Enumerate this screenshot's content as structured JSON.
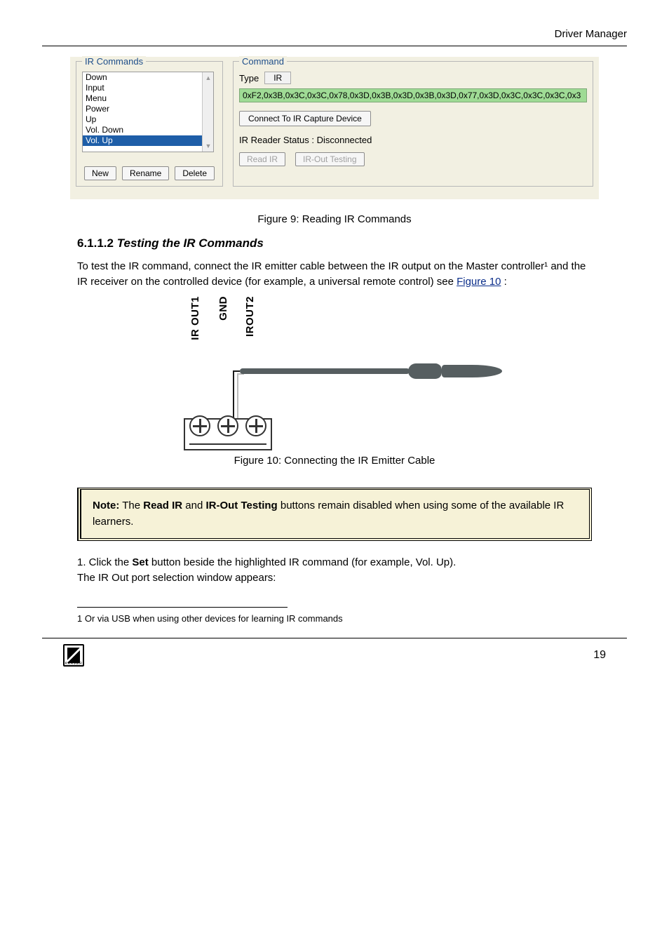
{
  "header": {
    "right": "Driver Manager"
  },
  "fig1": {
    "ir_commands": {
      "legend": "IR Commands",
      "items": [
        "Down",
        "Input",
        "Menu",
        "Power",
        "Up",
        "Vol. Down",
        "Vol. Up"
      ],
      "selected_index": 6,
      "buttons": {
        "new": "New",
        "rename": "Rename",
        "delete": "Delete"
      }
    },
    "command": {
      "legend": "Command",
      "type_label": "Type",
      "type_value": "IR",
      "hex": "0xF2,0x3B,0x3C,0x3C,0x78,0x3D,0x3B,0x3D,0x3B,0x3D,0x77,0x3D,0x3C,0x3C,0x3C,0x3",
      "connect_btn": "Connect To IR Capture Device",
      "status_prefix": "IR Reader Status :",
      "status_value": "Disconnected",
      "read_btn": "Read IR",
      "test_btn": "IR-Out Testing"
    }
  },
  "caption1": "Figure 9: Reading IR Commands",
  "section": {
    "number": "6.1.1.2",
    "title": "Testing the IR Commands"
  },
  "para1": "To test the IR command, connect the IR emitter cable between the IR output on the Master controller¹ and the IR receiver on the controlled device (for example, a universal remote control) see ",
  "para1_link": "Figure 10",
  "para1_tail": ":",
  "fig10_labels": {
    "a": "IR OUT1",
    "b": "GND",
    "c": "IROUT2"
  },
  "caption10": "Figure 10: Connecting the IR Emitter Cable",
  "note": {
    "title": "Note:",
    "body_1": "The ",
    "bold_1": "Read IR",
    "body_2": " and ",
    "bold_2": "IR-Out Testing",
    "body_3": " buttons remain disabled when using some of the available IR learners."
  },
  "list": {
    "item1_pre": "1. Click the ",
    "item1_bold": "Set",
    "item1_post": " button beside the highlighted IR command (for example, Vol. Up).",
    "item1_post2": "The IR Out port selection window appears:",
    "footnote_marker": "1",
    "footnote_text": "Or via USB when using other devices for learning IR commands"
  },
  "footer": {
    "page": "19",
    "logo_sub": "KRAMER"
  }
}
